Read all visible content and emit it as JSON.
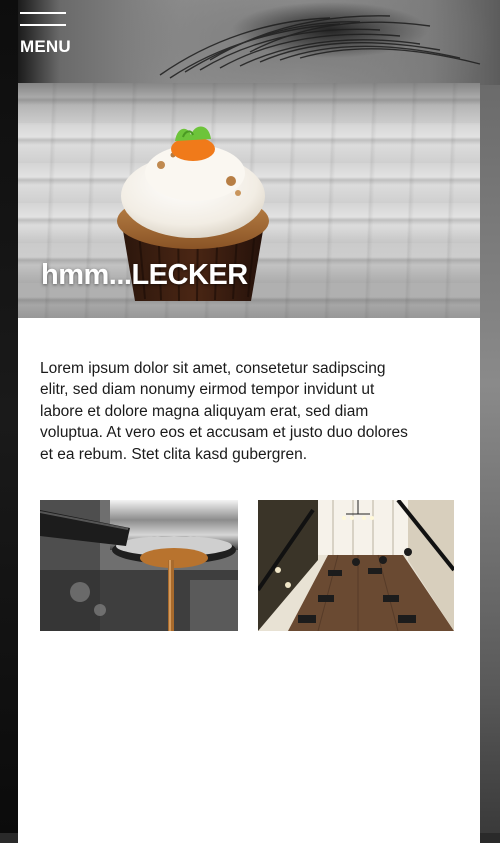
{
  "nav": {
    "menu_label": "MENU"
  },
  "hero": {
    "title": "hmm...LECKER",
    "image_icon": "cupcake-image"
  },
  "content": {
    "paragraph": "Lorem ipsum dolor sit amet, consetetur sadipscing elitr, sed diam nonumy eirmod tempor invidunt ut labore et dolore magna aliquyam erat, sed diam voluptua. At vero eos et accusam et justo duo dolores et ea rebum. Stet clita kasd gubergren."
  },
  "gallery": {
    "items": [
      {
        "name": "espresso-machine-image"
      },
      {
        "name": "cafe-interior-image"
      }
    ]
  },
  "colors": {
    "text": "#1a1a1a",
    "card_background": "#ffffff",
    "menu_color": "#ffffff"
  }
}
